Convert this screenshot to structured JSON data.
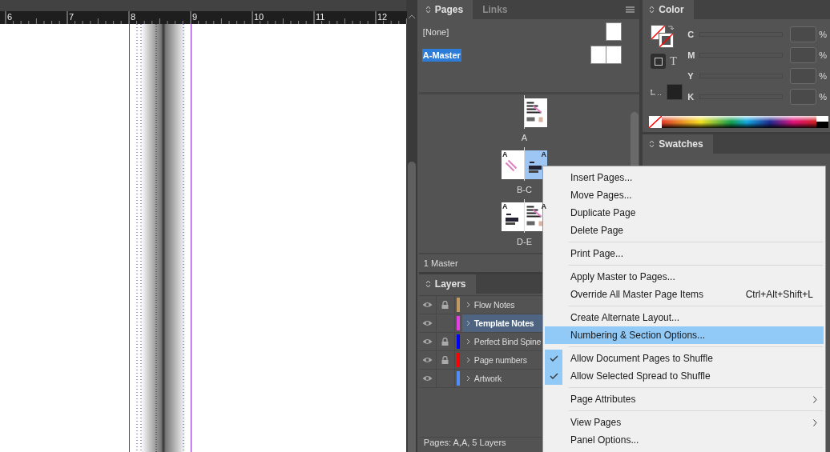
{
  "ruler": {
    "marks": [
      "6",
      "7",
      "8",
      "9",
      "10",
      "11",
      "12"
    ]
  },
  "pages_panel": {
    "tabs": [
      {
        "label": "Pages",
        "selected": true
      },
      {
        "label": "Links",
        "selected": false
      }
    ],
    "masters": [
      {
        "label": "[None]",
        "selected": false,
        "kind": "single"
      },
      {
        "label": "A-Master",
        "selected": true,
        "kind": "spread"
      }
    ],
    "spreads": [
      {
        "label": "A",
        "right": {
          "selected": false,
          "kind": "text"
        }
      },
      {
        "label": "B-C",
        "left": {
          "selected": false,
          "kind": "stripes",
          "master": "A"
        },
        "right": {
          "selected": true,
          "kind": "blocks",
          "master": "A"
        }
      },
      {
        "label": "D-E",
        "left": {
          "selected": false,
          "kind": "blocks",
          "master": "A"
        },
        "right": {
          "selected": false,
          "kind": "text",
          "master": "A"
        }
      }
    ],
    "footer": "1 Master"
  },
  "layers_panel": {
    "tab": "Layers",
    "layers": [
      {
        "name": "Flow Notes",
        "visible": true,
        "locked": true,
        "color": "#c49a63",
        "selected": false
      },
      {
        "name": "Template Notes",
        "visible": true,
        "locked": false,
        "color": "#e83ee8",
        "selected": true
      },
      {
        "name": "Perfect Bind Spine",
        "visible": true,
        "locked": true,
        "color": "#0000ff",
        "selected": false
      },
      {
        "name": "Page numbers",
        "visible": true,
        "locked": true,
        "color": "#ff0000",
        "selected": false
      },
      {
        "name": "Artwork",
        "visible": true,
        "locked": false,
        "color": "#4f8ef7",
        "selected": false
      }
    ],
    "status": "Pages: A,A, 5 Layers"
  },
  "color_panel": {
    "tab": "Color",
    "channels": [
      {
        "label": "C",
        "unit": "%",
        "disabled": true
      },
      {
        "label": "M",
        "unit": "%",
        "disabled": true
      },
      {
        "label": "Y",
        "unit": "%",
        "disabled": true
      },
      {
        "label": "K",
        "unit": "%",
        "disabled": true
      }
    ],
    "type_button": "T"
  },
  "swatches_panel": {
    "tab": "Swatches"
  },
  "context_menu": {
    "groups": [
      [
        {
          "label": "Insert Pages...",
          "checked": false,
          "selected": false,
          "submenu": false
        },
        {
          "label": "Move Pages...",
          "checked": false,
          "selected": false,
          "submenu": false
        },
        {
          "label": "Duplicate Page",
          "checked": false,
          "selected": false,
          "submenu": false
        },
        {
          "label": "Delete Page",
          "checked": false,
          "selected": false,
          "submenu": false
        }
      ],
      [
        {
          "label": "Print Page...",
          "checked": false,
          "selected": false,
          "submenu": false
        }
      ],
      [
        {
          "label": "Apply Master to Pages...",
          "checked": false,
          "selected": false,
          "submenu": false
        },
        {
          "label": "Override All Master Page Items",
          "shortcut": "Ctrl+Alt+Shift+L",
          "checked": false,
          "selected": false,
          "submenu": false
        }
      ],
      [
        {
          "label": "Create Alternate Layout...",
          "checked": false,
          "selected": false,
          "submenu": false
        },
        {
          "label": "Numbering & Section Options...",
          "checked": false,
          "selected": true,
          "submenu": false
        }
      ],
      [
        {
          "label": "Allow Document Pages to Shuffle",
          "checked": true,
          "selected": false,
          "submenu": false
        },
        {
          "label": "Allow Selected Spread to Shuffle",
          "checked": true,
          "selected": false,
          "submenu": false
        }
      ],
      [
        {
          "label": "Page Attributes",
          "checked": false,
          "selected": false,
          "submenu": true
        }
      ],
      [
        {
          "label": "View Pages",
          "checked": false,
          "selected": false,
          "submenu": true
        },
        {
          "label": "Panel Options...",
          "checked": false,
          "selected": false,
          "submenu": false
        }
      ]
    ]
  }
}
